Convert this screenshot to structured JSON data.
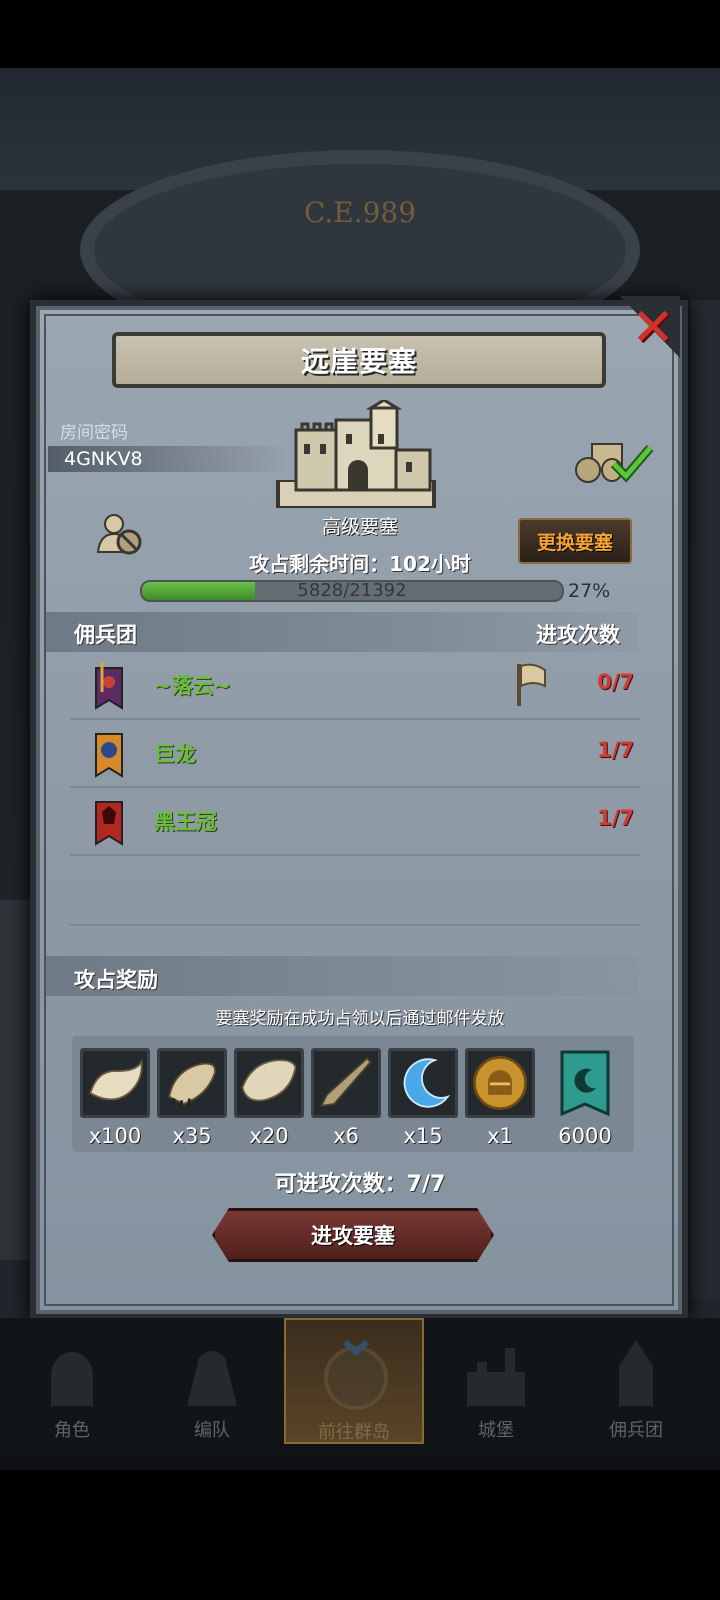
{
  "background": {
    "year_label": "C.E.989"
  },
  "dialog": {
    "title": "远崖要塞",
    "close_icon": "close-x-icon",
    "room": {
      "label": "房间密码",
      "code": "4GNKV8"
    },
    "fortress": {
      "name": "高级要塞",
      "icon": "castle-icon"
    },
    "change_button": "更换要塞",
    "time_remaining": "攻占剩余时间：102小时",
    "progress": {
      "text": "5828/21392",
      "current": 5828,
      "total": 21392,
      "percent_label": "27%",
      "fraction": 0.27
    },
    "table": {
      "header_left": "佣兵团",
      "header_right": "进攻次数",
      "rows": [
        {
          "name": "~落云~",
          "count": "0/7",
          "banner_icon": "purple-banner-icon",
          "has_flag": true
        },
        {
          "name": "巨龙",
          "count": "1/7",
          "banner_icon": "dragon-banner-icon",
          "has_flag": false
        },
        {
          "name": "黑王冠",
          "count": "1/7",
          "banner_icon": "red-banner-icon",
          "has_flag": false
        }
      ]
    },
    "rewards": {
      "header": "攻占奖励",
      "note": "要塞奖励在成功占领以后通过邮件发放",
      "items": [
        {
          "icon": "fur-icon",
          "qty": "x100"
        },
        {
          "icon": "claw-icon",
          "qty": "x35"
        },
        {
          "icon": "pelt-icon",
          "qty": "x20"
        },
        {
          "icon": "horn-icon",
          "qty": "x6"
        },
        {
          "icon": "crescent-crystal-icon",
          "qty": "x15"
        },
        {
          "icon": "knight-medal-icon",
          "qty": "x1"
        },
        {
          "icon": "guild-banner-icon",
          "qty": "6000"
        }
      ]
    },
    "attempts": "可进攻次数：7/7",
    "attack_button": "进攻要塞"
  },
  "nav": {
    "items": [
      {
        "label": "角色",
        "icon": "knight-helmet-icon",
        "active": false
      },
      {
        "label": "编队",
        "icon": "armored-knight-icon",
        "active": false
      },
      {
        "label": "前往群岛",
        "icon": "island-compass-icon",
        "active": true
      },
      {
        "label": "城堡",
        "icon": "castle-nav-icon",
        "active": false
      },
      {
        "label": "佣兵团",
        "icon": "mercenary-tower-icon",
        "active": false
      }
    ]
  },
  "colors": {
    "guild_name": "#6cbf3e",
    "attack_count": "#d23a35",
    "change_button_text": "#f2a236",
    "progress_fill": "#4ea437",
    "close_x": "#d4302a"
  }
}
